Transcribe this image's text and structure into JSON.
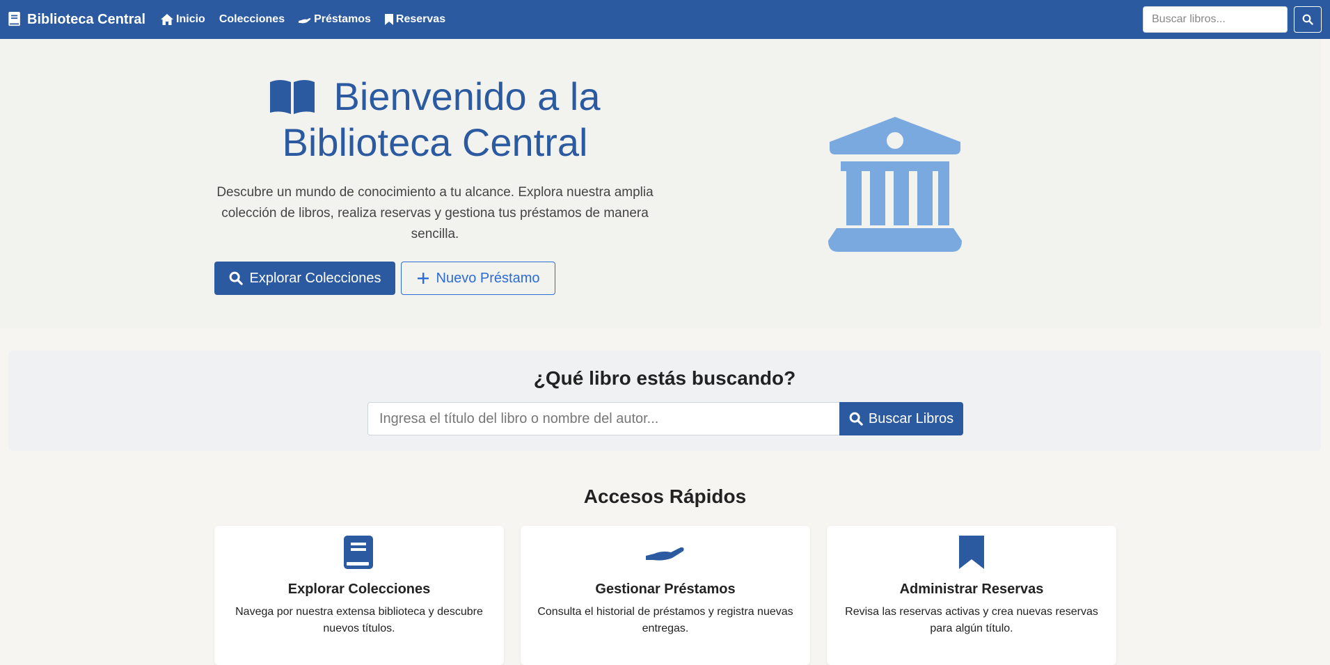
{
  "navbar": {
    "brand": "Biblioteca Central",
    "links": [
      {
        "label": "Inicio",
        "icon": "home-icon"
      },
      {
        "label": "Colecciones",
        "icon": ""
      },
      {
        "label": "Préstamos",
        "icon": "hand-holding-icon"
      },
      {
        "label": "Reservas",
        "icon": "bookmark-icon"
      }
    ],
    "search_placeholder": "Buscar libros..."
  },
  "hero": {
    "title": "Bienvenido a la Biblioteca Central",
    "description": "Descubre un mundo de conocimiento a tu alcance. Explora nuestra amplia colección de libros, realiza reservas y gestiona tus préstamos de manera sencilla.",
    "primary_button": "Explorar Colecciones",
    "secondary_button": "Nuevo Préstamo"
  },
  "search": {
    "title": "¿Qué libro estás buscando?",
    "placeholder": "Ingresa el título del libro o nombre del autor...",
    "button": "Buscar Libros"
  },
  "quick_access": {
    "title": "Accesos Rápidos",
    "cards": [
      {
        "title": "Explorar Colecciones",
        "description": "Navega por nuestra extensa biblioteca y descubre nuevos títulos.",
        "icon": "book-icon"
      },
      {
        "title": "Gestionar Préstamos",
        "description": "Consulta el historial de préstamos y registra nuevas entregas.",
        "icon": "hand-holding-icon"
      },
      {
        "title": "Administrar Reservas",
        "description": "Revisa las reservas activas y crea nuevas reservas para algún título.",
        "icon": "bookmark-icon"
      }
    ]
  },
  "colors": {
    "primary": "#2b5aa0",
    "accent": "#2b6cd6",
    "landmark": "#7aa9e0"
  }
}
